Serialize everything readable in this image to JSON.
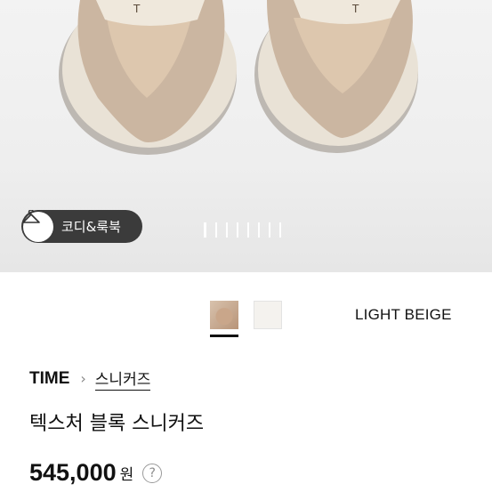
{
  "gallery": {
    "coordi_button_label": "코디&룩북",
    "coordi_icon": "hanger-icon",
    "indicator_count": 8,
    "indicator_active_index": 0
  },
  "colors": {
    "selected_name": "LIGHT BEIGE",
    "swatches": [
      {
        "name": "light-beige",
        "selected": true
      },
      {
        "name": "white",
        "selected": false
      }
    ]
  },
  "breadcrumb": {
    "brand": "TIME",
    "separator_icon": "chevron-right-icon",
    "chevron": "›",
    "category": "스니커즈"
  },
  "product": {
    "name": "텍스처 블록 스니커즈",
    "price": "545,000",
    "currency": "원",
    "help": "?"
  }
}
